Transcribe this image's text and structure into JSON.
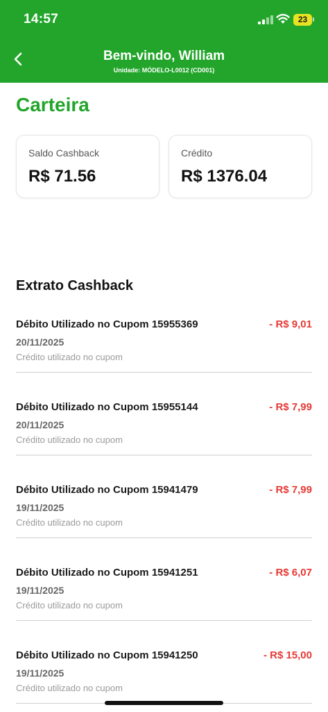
{
  "status_bar": {
    "time": "14:57",
    "battery": "23"
  },
  "header": {
    "title": "Bem-vindo, William",
    "subtitle": "Unidade: MÓDELO-L0012 (CD001)",
    "back_icon": "chevron-left-icon"
  },
  "page": {
    "title": "Carteira"
  },
  "cards": [
    {
      "label": "Saldo Cashback",
      "value": "R$ 71.56"
    },
    {
      "label": "Crédito",
      "value": "R$ 1376.04"
    }
  ],
  "statement": {
    "title": "Extrato Cashback",
    "items": [
      {
        "title": "Débito Utilizado no Cupom 15955369",
        "amount": "- R$ 9,01",
        "date": "20/11/2025",
        "description": "Crédito utilizado no cupom"
      },
      {
        "title": "Débito Utilizado no Cupom 15955144",
        "amount": "- R$ 7,99",
        "date": "20/11/2025",
        "description": "Crédito utilizado no cupom"
      },
      {
        "title": "Débito Utilizado no Cupom 15941479",
        "amount": "- R$ 7,99",
        "date": "19/11/2025",
        "description": "Crédito utilizado no cupom"
      },
      {
        "title": "Débito Utilizado no Cupom 15941251",
        "amount": "- R$ 6,07",
        "date": "19/11/2025",
        "description": "Crédito utilizado no cupom"
      },
      {
        "title": "Débito Utilizado no Cupom 15941250",
        "amount": "- R$ 15,00",
        "date": "19/11/2025",
        "description": "Crédito utilizado no cupom"
      }
    ]
  },
  "colors": {
    "brand_green": "#22a52a",
    "debit_red": "#e53935",
    "battery_yellow": "#e8e322"
  }
}
